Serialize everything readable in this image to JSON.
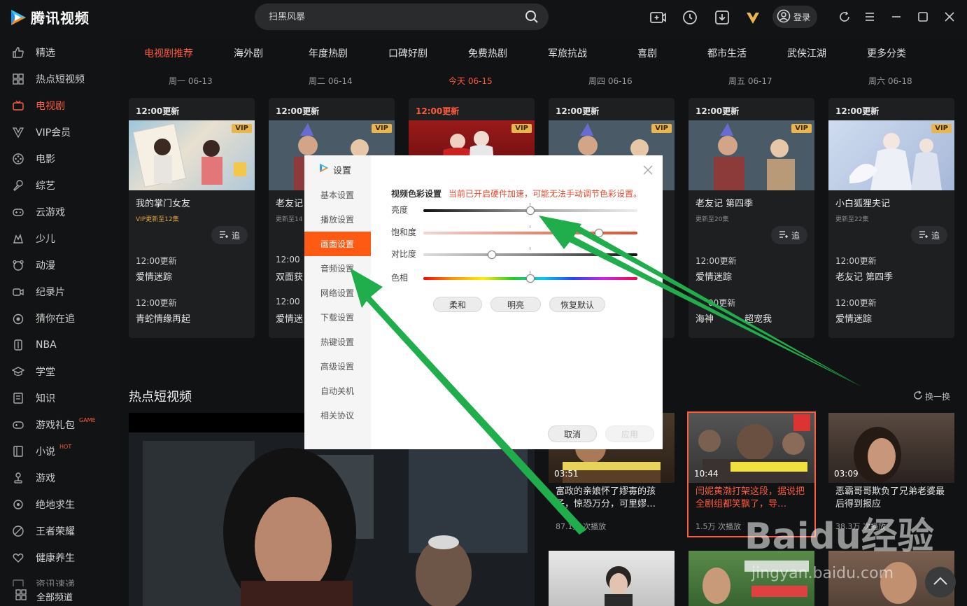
{
  "app": {
    "title": "腾讯视频"
  },
  "search": {
    "placeholder": "扫黑风暴"
  },
  "header": {
    "login_label": "登录"
  },
  "sidebar": {
    "items": [
      {
        "label": "精选",
        "icon": "thumb-up-icon"
      },
      {
        "label": "热点短视频",
        "icon": "grid-icon"
      },
      {
        "label": "电视剧",
        "icon": "tv-icon",
        "active": true
      },
      {
        "label": "VIP会员",
        "icon": "vip-icon"
      },
      {
        "label": "电影",
        "icon": "film-reel-icon"
      },
      {
        "label": "综艺",
        "icon": "microphone-icon"
      },
      {
        "label": "云游戏",
        "icon": "gamepad-icon"
      },
      {
        "label": "少儿",
        "icon": "kids-icon"
      },
      {
        "label": "动漫",
        "icon": "bear-icon"
      },
      {
        "label": "纪录片",
        "icon": "camera-icon"
      },
      {
        "label": "猜你在追",
        "icon": "eye-icon"
      },
      {
        "label": "NBA",
        "icon": "nba-icon"
      },
      {
        "label": "学堂",
        "icon": "graduation-cap-icon"
      },
      {
        "label": "知识",
        "icon": "book-icon"
      },
      {
        "label": "游戏礼包",
        "icon": "gift-gamepad-icon",
        "badge": "GAME"
      },
      {
        "label": "小说",
        "icon": "novel-icon",
        "badge": "HOT"
      },
      {
        "label": "游戏",
        "icon": "joystick-icon"
      },
      {
        "label": "绝地求生",
        "icon": "target-icon"
      },
      {
        "label": "王者荣耀",
        "icon": "crown-icon"
      },
      {
        "label": "健康养生",
        "icon": "heart-icon"
      },
      {
        "label": "资讯速递",
        "icon": "news-icon"
      }
    ],
    "all_channels": "全部频道"
  },
  "categories": [
    "电视剧推荐",
    "海外剧",
    "年度热剧",
    "口碑好剧",
    "免费热剧",
    "军旅抗战",
    "喜剧",
    "都市生活",
    "武侠江湖",
    "更多分类"
  ],
  "days": [
    "周一 06-13",
    "周二 06-14",
    "今天 06-15",
    "周四 06-16",
    "周五 06-17",
    "周六 06-18"
  ],
  "cards": [
    {
      "time": "12:00更新",
      "vip": "VIP",
      "title": "我的掌门女友",
      "sub": "VIP更新至12集",
      "follow": "追",
      "eps": [
        {
          "time": "12:00更新",
          "name": "爱情迷踪"
        },
        {
          "time": "12:00更新",
          "name": "青蛇情缘再起"
        }
      ]
    },
    {
      "time": "12:00更新",
      "vip": "VIP",
      "title": "老友记",
      "sub": "更新至14",
      "follow": "",
      "eps": [
        {
          "time": "12:00",
          "name": "双面获"
        },
        {
          "time": "12:00",
          "name": "爱情迷"
        }
      ]
    },
    {
      "time": "12:00更新",
      "vip": "VIP",
      "title": "",
      "sub": "",
      "follow": "",
      "eps": [
        {
          "time": "",
          "name": ""
        },
        {
          "time": "",
          "name": ""
        }
      ]
    },
    {
      "time": "12:00更新",
      "vip": "VIP",
      "title": "",
      "sub": "",
      "follow": "",
      "eps": [
        {
          "time": "",
          "name": ""
        },
        {
          "time": "",
          "name": ""
        }
      ]
    },
    {
      "time": "12:00更新",
      "vip": "VIP",
      "title": "老友记 第四季",
      "sub": "更新至20集",
      "follow": "追",
      "eps": [
        {
          "time": "12:00更新",
          "name": "爱情迷踪"
        },
        {
          "time": "00更新",
          "name": "海神"
        },
        {
          "time": "",
          "name": "超宠我"
        }
      ]
    },
    {
      "time": "12:00更新",
      "vip": "VIP",
      "title": "小白狐狸夫记",
      "sub": "更新至22集",
      "follow": "追",
      "eps": [
        {
          "time": "12:00更新",
          "name": "老友记 第四季"
        },
        {
          "time": "12:00更新",
          "name": "爱情迷踪"
        }
      ]
    }
  ],
  "hot_section": {
    "title": "热点短视频",
    "refresh": "换一换"
  },
  "short_videos": [
    {
      "duration": "03:51",
      "title": "富政的亲娘怀了嫪毐的孩子，惊恐万分，可里嫪…",
      "plays": "87.1万 次播放"
    },
    {
      "duration": "10:44",
      "title": "闫妮黄渤打架这段，据说把全剧组都笑飘了，导…",
      "plays": "1.5万 次播放",
      "highlight": true
    },
    {
      "duration": "03:09",
      "title": "恶霸哥哥欺负了兄弟老婆最后得到报应",
      "plays": "38.3万 次播放"
    }
  ],
  "settings": {
    "title": "设置",
    "menu": [
      "基本设置",
      "播放设置",
      "画面设置",
      "音频设置",
      "网络设置",
      "下载设置",
      "热键设置",
      "高级设置",
      "自动关机",
      "相关协议"
    ],
    "active_index": 2,
    "heading": "视频色彩设置",
    "warning": "当前已开启硬件加速，可能无法手动调节色彩设置。",
    "sliders": [
      {
        "label": "亮度",
        "value": 0.5
      },
      {
        "label": "饱和度",
        "value": 0.82
      },
      {
        "label": "对比度",
        "value": 0.32
      },
      {
        "label": "色相",
        "value": 0.5
      }
    ],
    "presets": [
      "柔和",
      "明亮",
      "恢复默认"
    ],
    "cancel": "取消",
    "apply": "应用"
  },
  "watermark": {
    "text": "Baidu经验",
    "url": "jingyan.baidu.com"
  },
  "colors": {
    "accent": "#ff5a3d",
    "vip": "#e8b64c",
    "arrow": "#1fae4b"
  }
}
